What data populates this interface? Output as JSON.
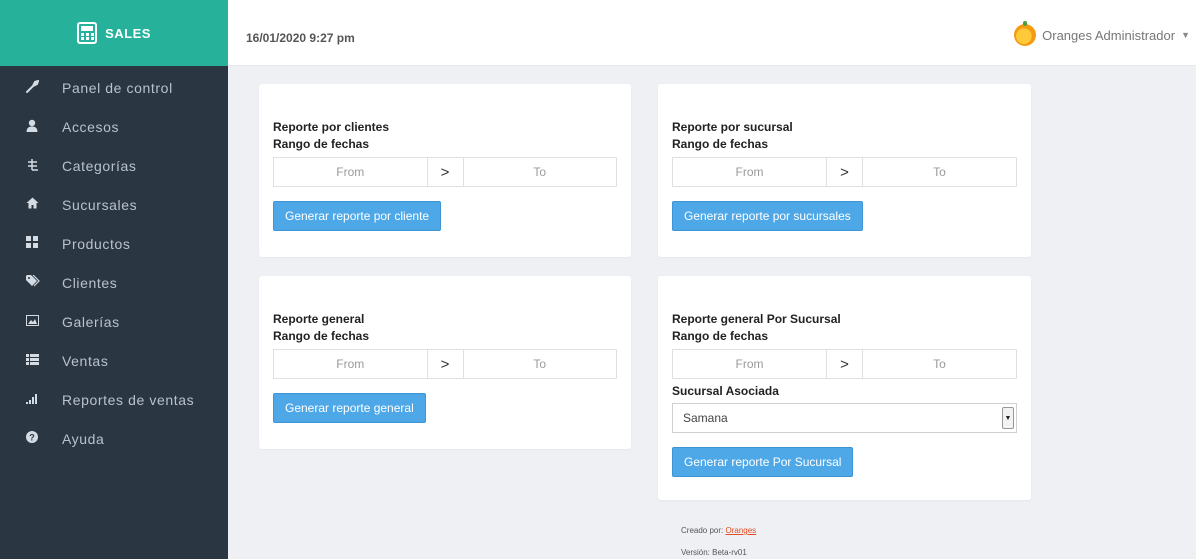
{
  "brand": {
    "name": "SALES",
    "icon": "calculator-icon"
  },
  "header": {
    "datetime": "16/01/2020 9:27 pm",
    "user_name": "Oranges Administrador",
    "avatar_icon": "orange-icon"
  },
  "sidebar": {
    "items": [
      {
        "label": "Panel de control",
        "icon": "wrench-icon"
      },
      {
        "label": "Accesos",
        "icon": "user-icon"
      },
      {
        "label": "Categorías",
        "icon": "sitemap-icon"
      },
      {
        "label": "Sucursales",
        "icon": "home-icon"
      },
      {
        "label": "Productos",
        "icon": "grid-icon"
      },
      {
        "label": "Clientes",
        "icon": "tags-icon"
      },
      {
        "label": "Galerías",
        "icon": "image-icon"
      },
      {
        "label": "Ventas",
        "icon": "list-icon"
      },
      {
        "label": "Reportes de ventas",
        "icon": "bar-chart-icon"
      },
      {
        "label": "Ayuda",
        "icon": "question-icon"
      }
    ]
  },
  "cards": {
    "clientes": {
      "title": "Reporte por clientes",
      "subtitle": "Rango de fechas",
      "from_placeholder": "From",
      "to_placeholder": "To",
      "button": "Generar reporte por cliente"
    },
    "sucursal": {
      "title": "Reporte por sucursal",
      "subtitle": "Rango de fechas",
      "from_placeholder": "From",
      "to_placeholder": "To",
      "button": "Generar reporte por sucursales"
    },
    "general": {
      "title": "Reporte general",
      "subtitle": "Rango de fechas",
      "from_placeholder": "From",
      "to_placeholder": "To",
      "button": "Generar reporte general"
    },
    "general_sucursal": {
      "title": "Reporte general Por Sucursal",
      "subtitle": "Rango de fechas",
      "from_placeholder": "From",
      "to_placeholder": "To",
      "select_label": "Sucursal Asociada",
      "select_value": "Samana",
      "button": "Generar reporte Por Sucursal"
    }
  },
  "footer": {
    "created_by_label": "Creado por:",
    "created_by_link": "Oranges",
    "version": "Versión: Beta-rv01"
  },
  "colors": {
    "brand": "#26b29a",
    "sidebar": "#2b3643",
    "button": "#4ea8e8",
    "background": "#eef0f4",
    "link": "#e34c26"
  }
}
